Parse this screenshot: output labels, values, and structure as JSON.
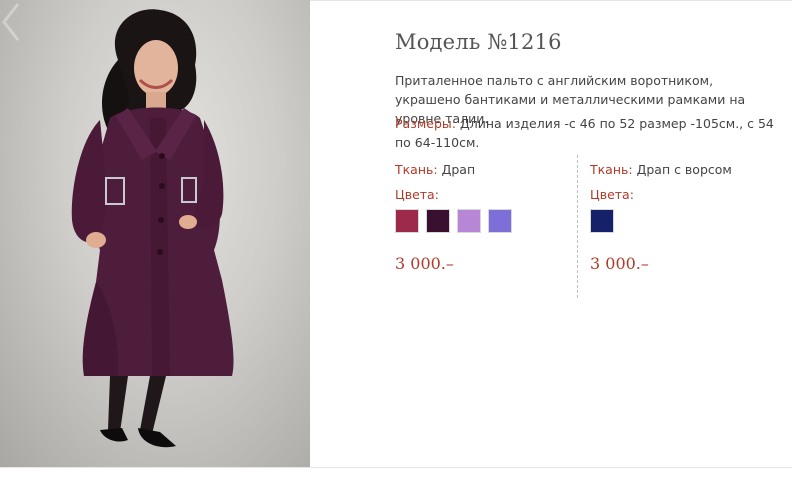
{
  "product": {
    "title": "Модель №1216",
    "description": "Приталенное пальто с английским воротником, украшено бантиками и металлическими рамками на уровне талии.",
    "sizes_label": "Размеры:",
    "sizes_text": " Длина изделия -с 46 по 52 размер -105см., с 54 по 64-110см."
  },
  "variants": [
    {
      "fabric_label": "Ткань:",
      "fabric_value": " Драп",
      "colors_label": "Цвета:",
      "swatches": [
        "#9e2a4a",
        "#3a1030",
        "#b786d6",
        "#7c6fd8"
      ],
      "price": "3 000.–"
    },
    {
      "fabric_label": "Ткань:",
      "fabric_value": " Драп с ворсом",
      "colors_label": "Цвета:",
      "swatches": [
        "#15226a"
      ],
      "price": "3 000.–"
    }
  ],
  "colors": {
    "accent": "#b03a2a",
    "coat": "#4e1d3c"
  },
  "icons": {
    "prev": "chevron-left-icon"
  }
}
